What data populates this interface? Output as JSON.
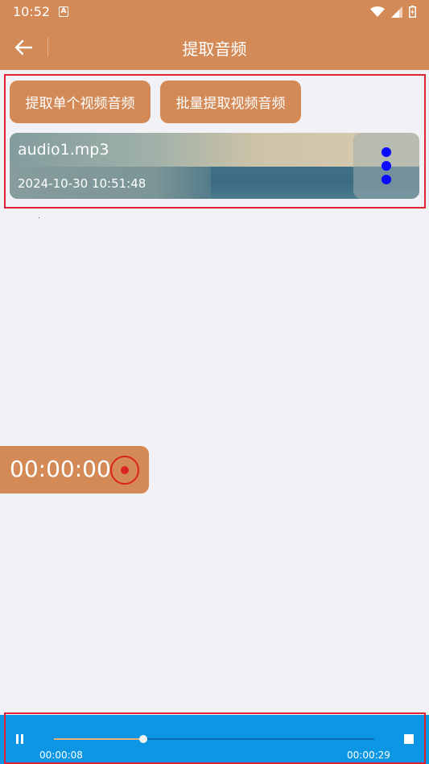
{
  "status_bar": {
    "time": "10:52",
    "a_icon_text": "A",
    "icons": [
      "wifi-icon",
      "signal-icon",
      "battery-icon"
    ]
  },
  "toolbar": {
    "title": "提取音频",
    "back_icon": "arrow-left-icon"
  },
  "actions": {
    "single_label": "提取单个视频音频",
    "batch_label": "批量提取视频音频"
  },
  "audio_list": [
    {
      "name": "audio1.mp3",
      "date": "2024-10-30 10:51:48"
    }
  ],
  "recorder": {
    "time": "00:00:00"
  },
  "player": {
    "current_time": "00:00:08",
    "total_time": "00:00:29",
    "progress_fraction": 0.28
  },
  "colors": {
    "accent": "#d48a57",
    "player_bg": "#0c96e4",
    "record_red": "#d9241e",
    "more_dot_blue": "#0a0aff",
    "highlight_outline": "#dd2233"
  }
}
